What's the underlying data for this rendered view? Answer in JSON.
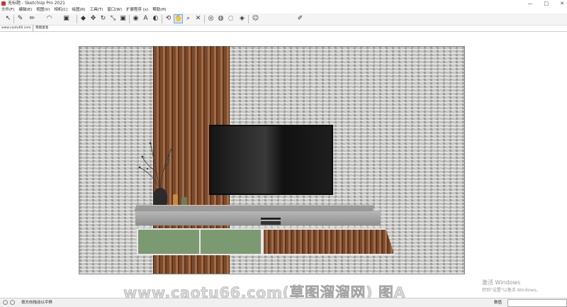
{
  "window": {
    "title": "无标题 - SketchUp Pro 2021",
    "controls": [
      "—",
      "□",
      "✕"
    ]
  },
  "menu": {
    "items": [
      "文件(F)",
      "编辑(E)",
      "视图(V)",
      "相机(C)",
      "绘图(R)",
      "工具(T)",
      "窗口(W)",
      "扩展程序 (x)",
      "帮助(H)"
    ]
  },
  "toolbar": {
    "tools": [
      {
        "name": "select-icon",
        "glyph": "↖"
      },
      {
        "name": "eraser-icon",
        "glyph": "✎"
      },
      {
        "name": "pencil-icon",
        "glyph": "✏"
      },
      {
        "name": "arc-icon",
        "glyph": "◠"
      },
      {
        "name": "rectangle-icon",
        "glyph": "▣"
      },
      {
        "name": "pushpull-icon",
        "glyph": "◆"
      },
      {
        "name": "move-icon",
        "glyph": "✥"
      },
      {
        "name": "rotate-icon",
        "glyph": "↻"
      },
      {
        "name": "scale-icon",
        "glyph": "⤡"
      },
      {
        "name": "tape-icon",
        "glyph": "◉"
      },
      {
        "name": "text-icon",
        "glyph": "A"
      },
      {
        "name": "paint-icon",
        "glyph": "◐"
      },
      {
        "name": "orbit-icon",
        "glyph": "⟲"
      },
      {
        "name": "pan-icon",
        "glyph": "✋"
      },
      {
        "name": "zoom-icon",
        "glyph": "⌕"
      },
      {
        "name": "zoom-extents-icon",
        "glyph": "✕"
      },
      {
        "name": "warehouse-icon",
        "glyph": "◎"
      },
      {
        "name": "extension-icon",
        "glyph": "◍"
      },
      {
        "name": "layout-icon",
        "glyph": "◌"
      },
      {
        "name": "style-icon",
        "glyph": "◈"
      },
      {
        "name": "account-icon",
        "glyph": "☺"
      },
      {
        "name": "report-icon",
        "glyph": "✐"
      }
    ]
  },
  "tabs": {
    "site": "www.caotu66.com",
    "scene": "草图溜溜"
  },
  "status": {
    "hint": "按方向拖动以平移",
    "measure_label": "数值"
  },
  "watermark": "www.caotu66.com(草图溜溜网) 图A",
  "os_notice": {
    "line1": "激活 Windows",
    "line2": "转到\"设置\"以激活 Windows。"
  }
}
